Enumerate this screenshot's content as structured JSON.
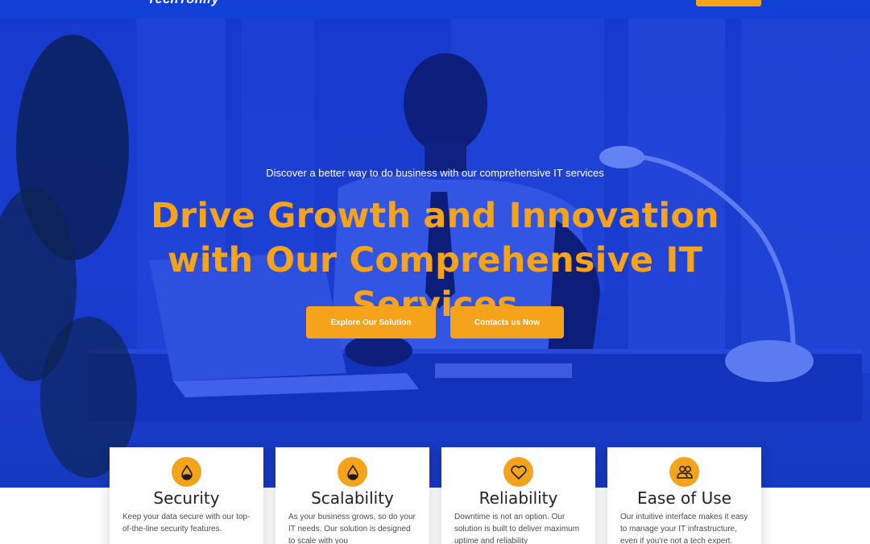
{
  "header": {
    "logo_text": "TechTonify",
    "cta_label": ""
  },
  "hero": {
    "subtitle": "Discover a better way to do business with our comprehensive IT services",
    "title": "Drive Growth and Innovation with Our Comprehensive IT Services",
    "buttons": [
      {
        "label": "Explore Our Solution"
      },
      {
        "label": "Contacts us Now"
      }
    ]
  },
  "features": [
    {
      "title": "Security",
      "icon": "water-drop-icon",
      "text": "Keep your data secure with our top-of-the-line security features."
    },
    {
      "title": "Scalability",
      "icon": "water-drop-icon",
      "text": "As your business grows, so do your IT needs. Our solution is designed to scale with you"
    },
    {
      "title": "Reliability",
      "icon": "heart-icon",
      "text": "Downtime is not an option. Our solution is built to deliver maximum uptime and reliability"
    },
    {
      "title": "Ease of Use",
      "icon": "users-icon",
      "text": "Our intuitive interface makes it easy to manage your IT infrastructure, even if you're not a tech expert."
    }
  ],
  "colors": {
    "brand_blue": "#1240d6",
    "accent_orange": "#f5a31a",
    "card_bg": "#ffffff"
  }
}
